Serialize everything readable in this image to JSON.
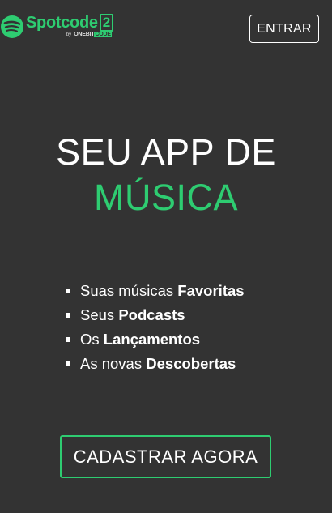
{
  "header": {
    "logo_word": "Spotcode",
    "logo_number": "2",
    "logo_by": "by",
    "logo_brand_main": "ONEBIT",
    "logo_brand_code": "CODE",
    "enter_label": "ENTRAR"
  },
  "hero": {
    "line1": "SEU APP DE",
    "line2": "MÚSICA"
  },
  "features": [
    {
      "prefix": "Suas músicas",
      "bold": "Favoritas"
    },
    {
      "prefix": "Seus",
      "bold": "Podcasts"
    },
    {
      "prefix": "Os",
      "bold": "Lançamentos"
    },
    {
      "prefix": "As novas",
      "bold": "Descobertas"
    }
  ],
  "cta": {
    "label": "CADASTRAR AGORA"
  },
  "colors": {
    "background": "#333333",
    "accent": "#2ecc71",
    "text": "#ffffff"
  },
  "icons": {
    "logo": "spotify-like-waves-icon"
  }
}
